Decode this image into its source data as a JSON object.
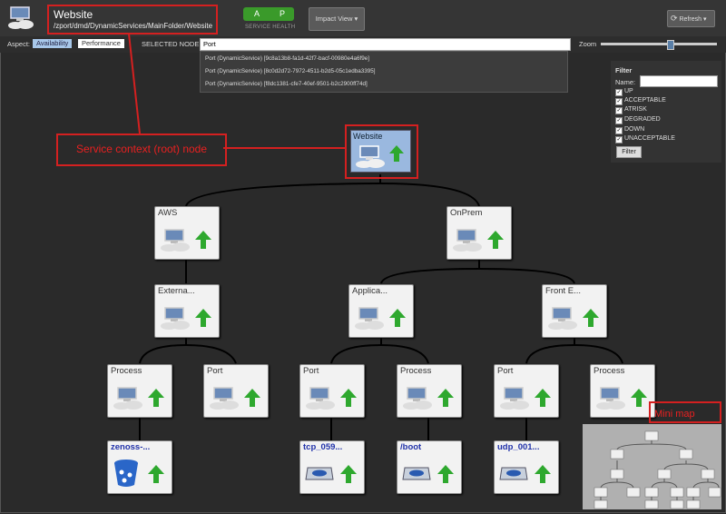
{
  "header": {
    "title": "Website",
    "path": "/zport/dmd/DynamicServices/MainFolder/Website",
    "health_a": "A",
    "health_p": "P",
    "health_label": "SERVICE HEALTH",
    "impact_view": "Impact View",
    "refresh": "Refresh"
  },
  "toolbar": {
    "aspect_label": "Aspect:",
    "tab_availability": "Availability",
    "tab_performance": "Performance",
    "selected_node_label": "SELECTED NODE:",
    "selected_node_value": "Port",
    "zoom_label": "Zoom"
  },
  "dropdown": {
    "items": [
      "Port (DynamicService) [9c8a13b8-fa1d-42f7-bacf-00980e4a6f9e]",
      "Port (DynamicService) [8c0d2d72-7972-4511-b2d5-05c1edba3395]",
      "Port (DynamicService) [f8dc1381-cfe7-40ef-9501-b2c2900ff74d]"
    ]
  },
  "filter": {
    "title": "Filter",
    "name_label": "Name:",
    "name_value": "",
    "options": [
      "UP",
      "ACCEPTABLE",
      "ATRISK",
      "DEGRADED",
      "DOWN",
      "UNACCEPTABLE"
    ],
    "button": "Filter"
  },
  "annotations": {
    "root_callout": "Service context (root) node",
    "minimap_callout": "Mini map"
  },
  "graph": {
    "root": "Website",
    "level1": [
      "AWS",
      "OnPrem"
    ],
    "level2": [
      "Externa...",
      "Applica...",
      "Front E..."
    ],
    "level3": [
      "Process",
      "Port",
      "Port",
      "Process",
      "Port",
      "Process"
    ],
    "level4": [
      "zenoss-...",
      "tcp_059...",
      "/boot",
      "udp_001..."
    ]
  },
  "colors": {
    "health_green": "#3a9a2a",
    "status_up_arrow": "#2ea82e",
    "root_node_fill": "#9ab8df",
    "annotation_red": "#d42020"
  }
}
